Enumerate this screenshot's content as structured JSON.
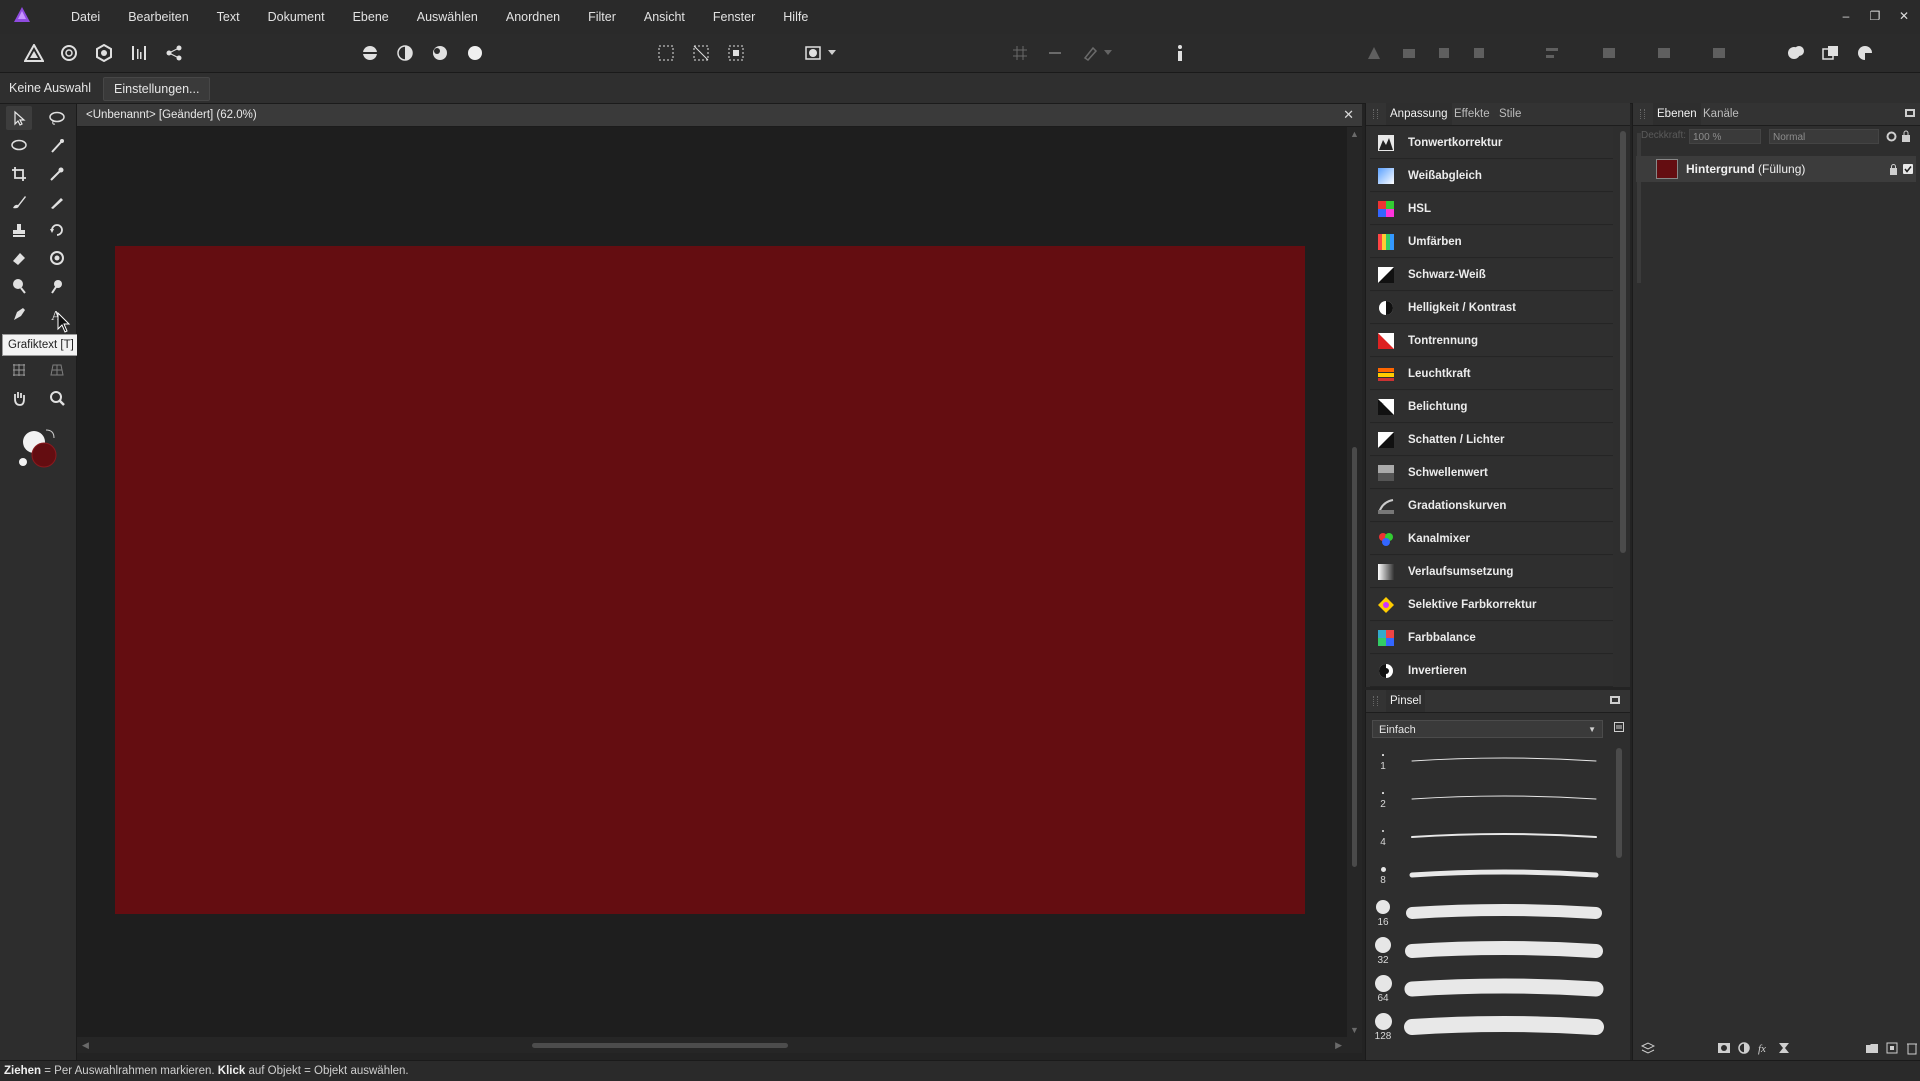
{
  "app": {
    "accent_color": "#7e3ad8"
  },
  "menubar": {
    "items": [
      "Datei",
      "Bearbeiten",
      "Text",
      "Dokument",
      "Ebene",
      "Auswählen",
      "Anordnen",
      "Filter",
      "Ansicht",
      "Fenster",
      "Hilfe"
    ],
    "window_controls": {
      "minimize": "–",
      "restore": "❐",
      "close": "✕"
    }
  },
  "contextbar": {
    "selection_label": "Keine Auswahl",
    "settings_button": "Einstellungen..."
  },
  "tooltip": {
    "text": "Grafiktext [T]"
  },
  "document": {
    "tab_title": "<Unbenannt> [Geändert] (62.0%)",
    "close_glyph": "✕",
    "artboard_color": "#640d11"
  },
  "adjustments_panel": {
    "tabs": [
      "Anpassung",
      "Effekte",
      "Stile"
    ],
    "active_tab": "Anpassung",
    "items": [
      {
        "label": "Tonwertkorrektur",
        "icon": "levels-icon"
      },
      {
        "label": "Weißabgleich",
        "icon": "white-balance-icon"
      },
      {
        "label": "HSL",
        "icon": "hsl-icon"
      },
      {
        "label": "Umfärben",
        "icon": "recolor-icon"
      },
      {
        "label": "Schwarz-Weiß",
        "icon": "black-white-icon"
      },
      {
        "label": "Helligkeit / Kontrast",
        "icon": "brightness-contrast-icon"
      },
      {
        "label": "Tontrennung",
        "icon": "posterize-icon"
      },
      {
        "label": "Leuchtkraft",
        "icon": "vibrance-icon"
      },
      {
        "label": "Belichtung",
        "icon": "exposure-icon"
      },
      {
        "label": "Schatten / Lichter",
        "icon": "shadows-highlights-icon"
      },
      {
        "label": "Schwellenwert",
        "icon": "threshold-icon"
      },
      {
        "label": "Gradationskurven",
        "icon": "curves-icon"
      },
      {
        "label": "Kanalmixer",
        "icon": "channel-mixer-icon"
      },
      {
        "label": "Verlaufsumsetzung",
        "icon": "gradient-map-icon"
      },
      {
        "label": "Selektive Farbkorrektur",
        "icon": "selective-color-icon"
      },
      {
        "label": "Farbbalance",
        "icon": "color-balance-icon"
      },
      {
        "label": "Invertieren",
        "icon": "invert-icon"
      }
    ]
  },
  "brush_panel": {
    "title": "Pinsel",
    "category": "Einfach",
    "sizes": [
      "1",
      "2",
      "4",
      "8",
      "16",
      "32",
      "64",
      "128"
    ]
  },
  "layers_panel": {
    "tabs": [
      "Ebenen",
      "Kanäle"
    ],
    "active_tab": "Ebenen",
    "opacity_label": "Deckkraft:",
    "opacity": "100 %",
    "blend_mode": "Normal",
    "layers": [
      {
        "name": "Hintergrund",
        "suffix": "(Füllung)",
        "color": "#640d11"
      }
    ]
  },
  "status": {
    "part1_bold": "Ziehen",
    "part1": " = Per Auswahlrahmen markieren. ",
    "part2_bold": "Klick",
    "part2": " auf Objekt = Objekt auswählen."
  }
}
